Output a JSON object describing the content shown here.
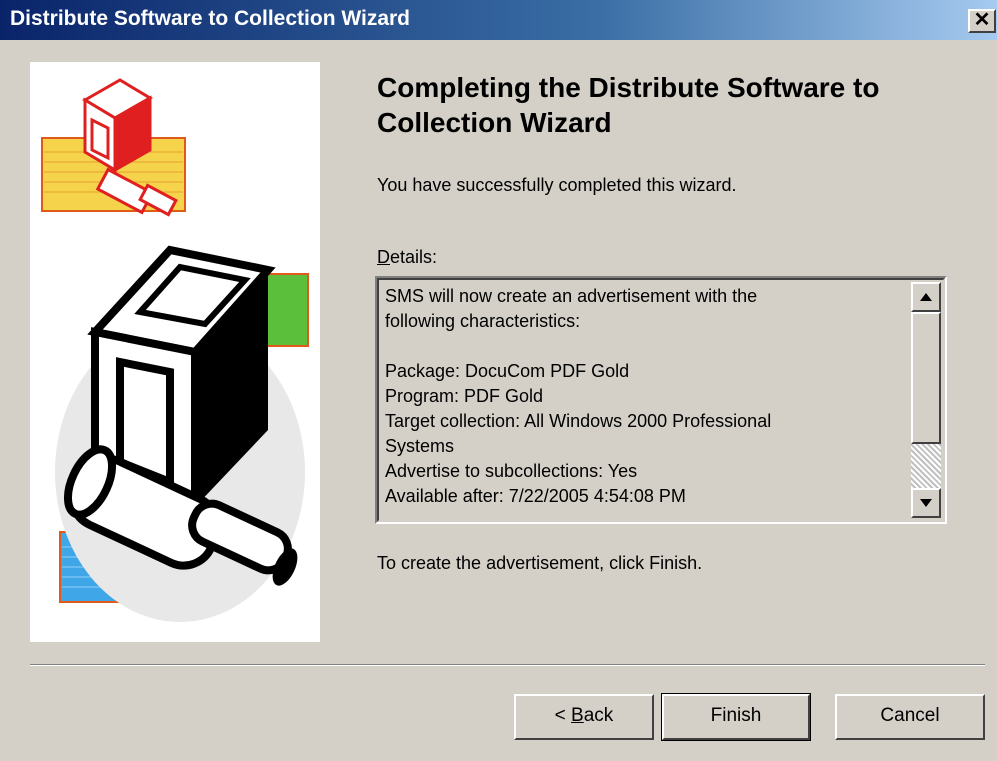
{
  "window": {
    "title": "Distribute Software to Collection Wizard",
    "close_glyph": "✕"
  },
  "content": {
    "heading": "Completing the Distribute Software to Collection Wizard",
    "subtitle": "You have successfully completed this wizard.",
    "details_label_prefix": "D",
    "details_label_rest": "etails:",
    "details_lines": [
      "SMS will now create an advertisement with the",
      "following characteristics:",
      "",
      "Package: DocuCom PDF Gold",
      "Program: PDF Gold",
      "Target collection: All Windows 2000 Professional",
      "Systems",
      "Advertise to subcollections: Yes",
      "Available after: 7/22/2005 4:54:08 PM"
    ],
    "finish_hint": "To create the advertisement, click Finish."
  },
  "buttons": {
    "back_prefix": "< ",
    "back_mnemonic": "B",
    "back_rest": "ack",
    "finish": "Finish",
    "cancel": "Cancel"
  },
  "icons": {
    "title_close": "close-icon",
    "scroll_up": "arrow-up-icon",
    "scroll_down": "arrow-down-icon",
    "wizard_art": "wizard-computer-icon"
  },
  "colors": {
    "titlebar_start": "#0a246a",
    "titlebar_end": "#a6caf0",
    "dialog_bg": "#d4d0c8",
    "art_yellow": "#f5d34a",
    "art_green": "#5cbf3c",
    "art_blue": "#3fa6e8",
    "art_red": "#e02020"
  }
}
